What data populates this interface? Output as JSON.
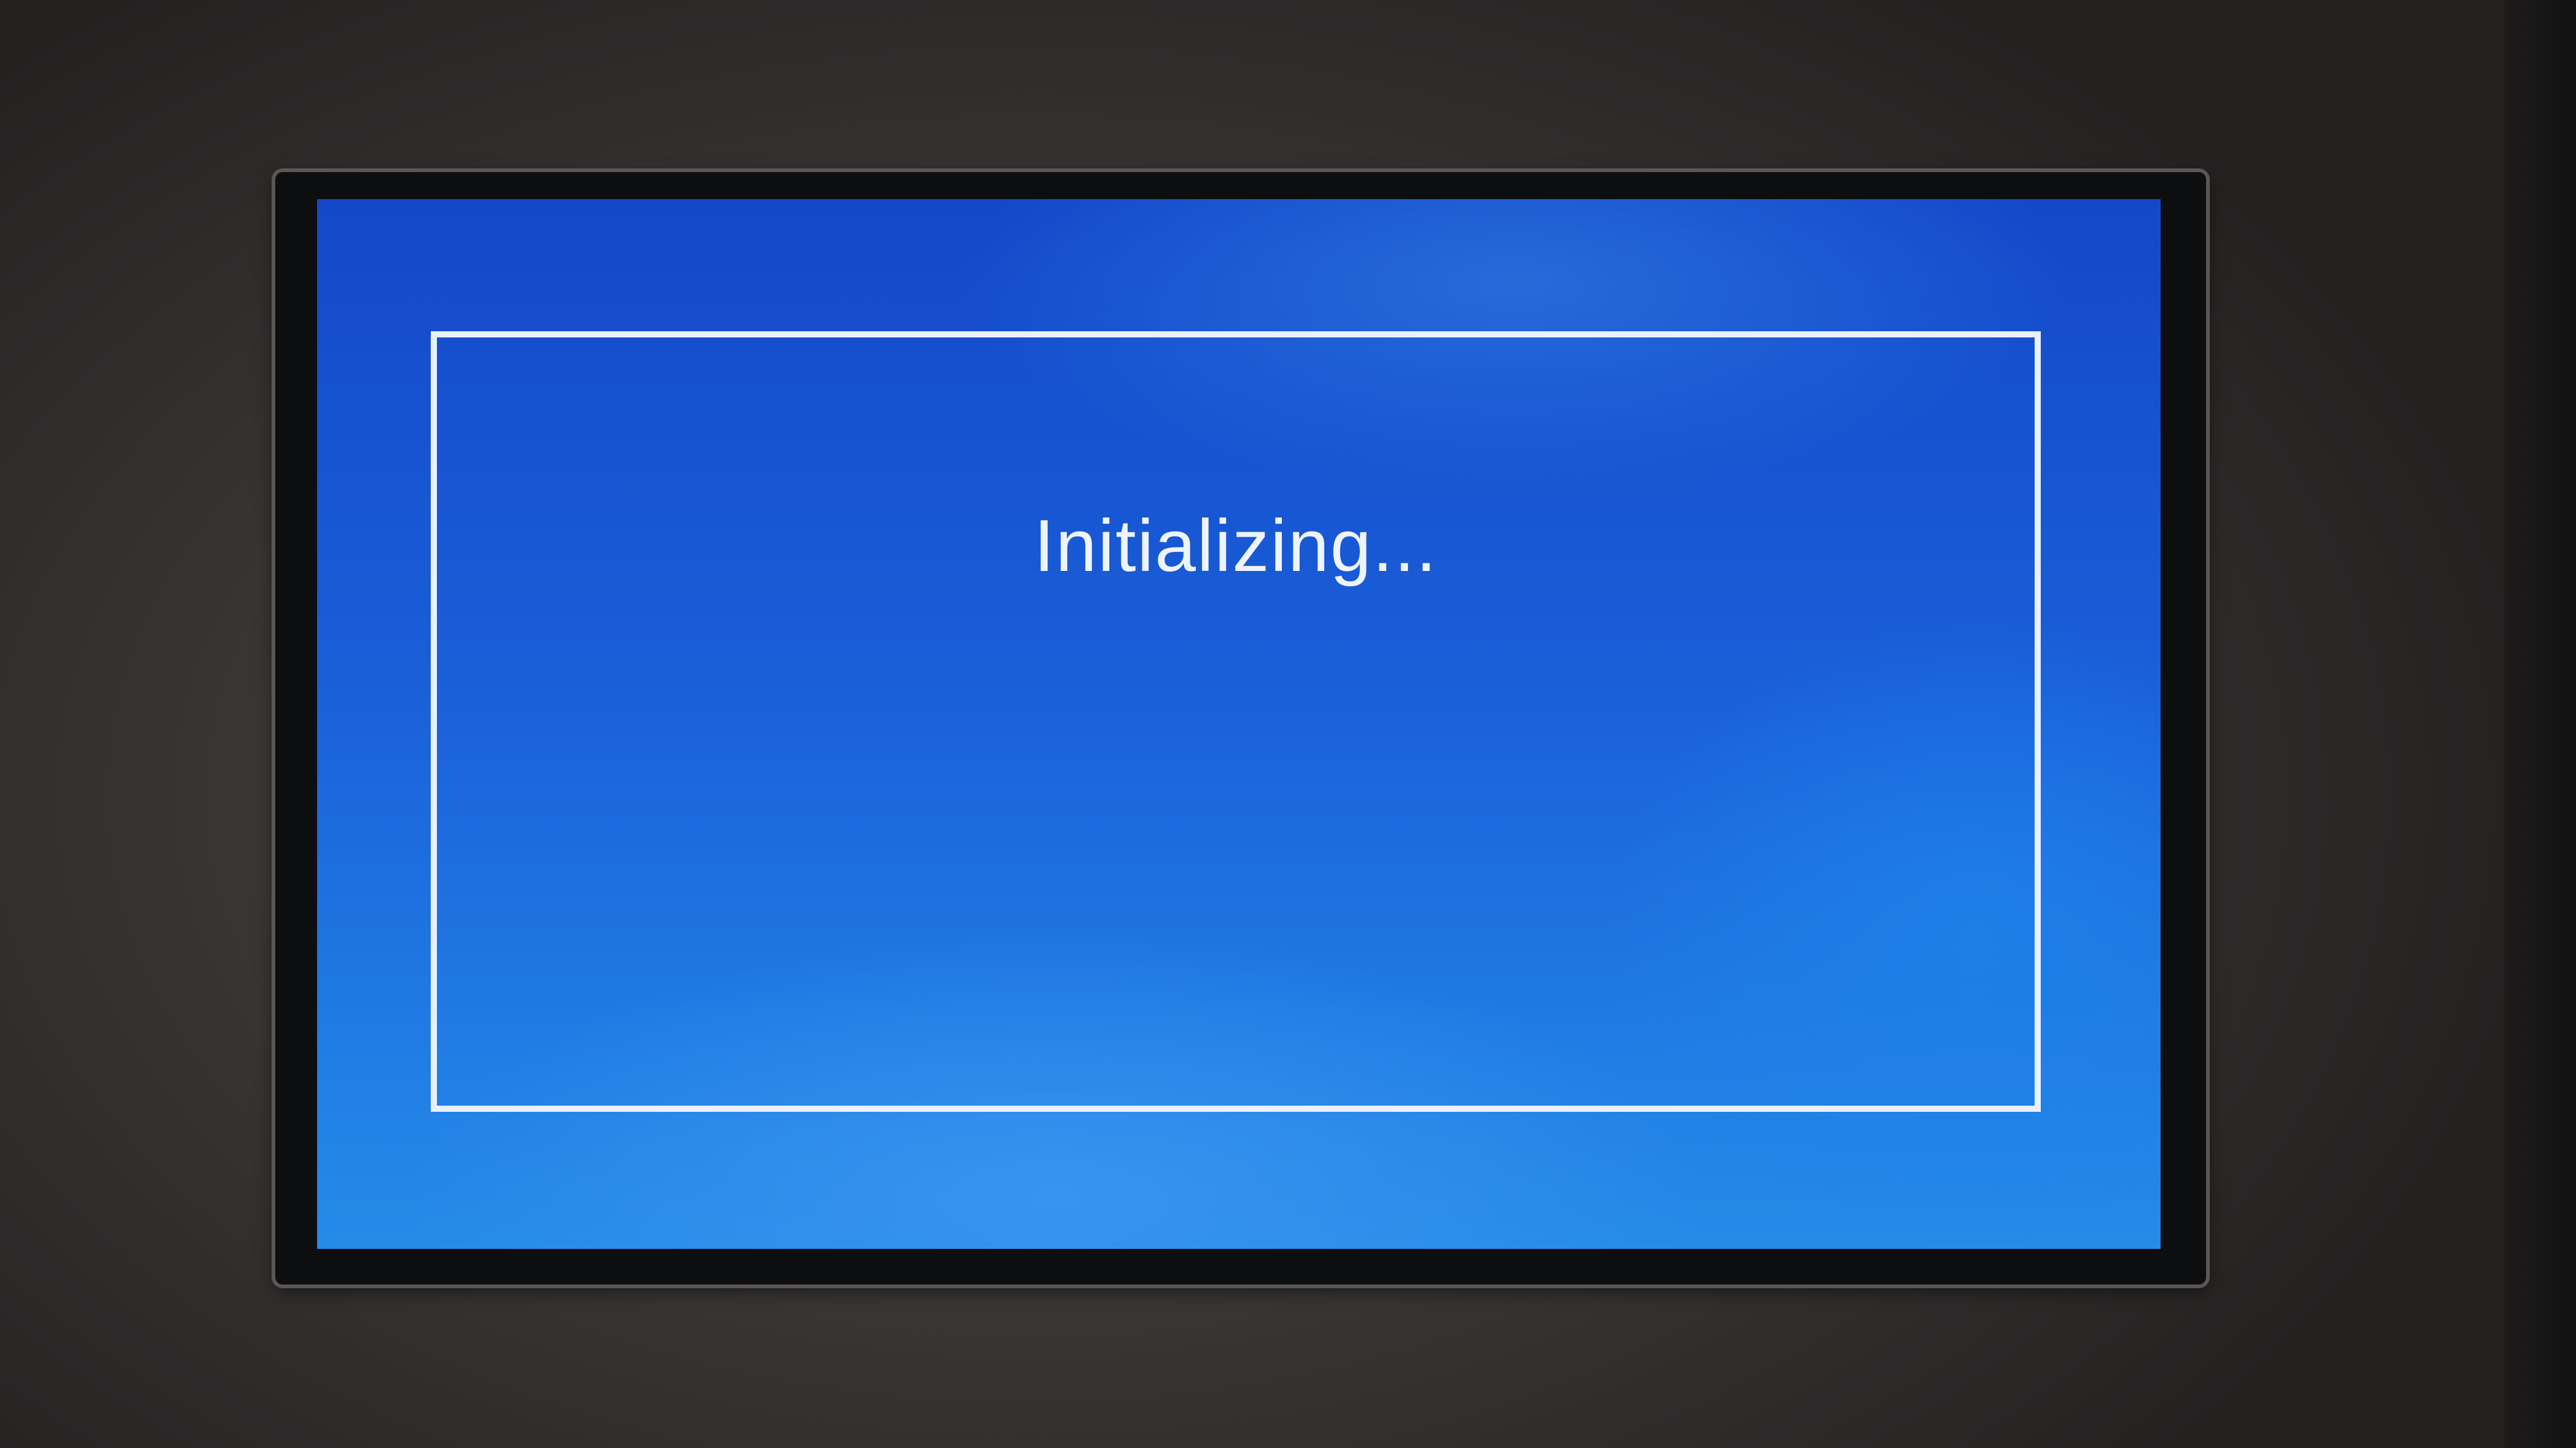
{
  "screen": {
    "status_text": "Initializing..."
  },
  "colors": {
    "screen_background": "#1a5ed8",
    "frame_border": "#e9f1ff",
    "text": "#eef4ff",
    "bezel": "#0d0e10",
    "device_body": "#3b3837"
  }
}
